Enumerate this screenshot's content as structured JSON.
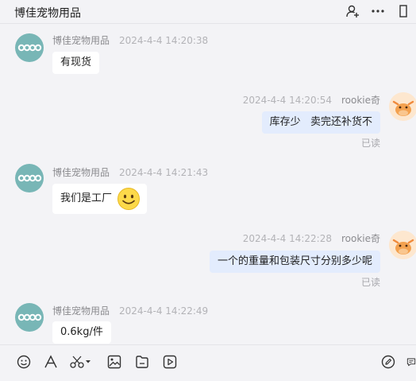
{
  "header": {
    "title": "博佳宠物用品"
  },
  "messages": [
    {
      "side": "left",
      "name": "博佳宠物用品",
      "time": "2024-4-4 14:20:38",
      "text": "有现货"
    },
    {
      "side": "right",
      "name": "rookie奇",
      "time": "2024-4-4 14:20:54",
      "text": "库存少   卖完还补货不",
      "status": "已读"
    },
    {
      "side": "left",
      "name": "博佳宠物用品",
      "time": "2024-4-4 14:21:43",
      "text": "我们是工厂",
      "emoji": "smile-emoji"
    },
    {
      "side": "right",
      "name": "rookie奇",
      "time": "2024-4-4 14:22:28",
      "text": "一个的重量和包装尺寸分别多少呢",
      "status": "已读"
    },
    {
      "side": "left",
      "name": "博佳宠物用品",
      "time": "2024-4-4 14:22:49",
      "text": "0.6kg/件"
    }
  ],
  "toolbar": {
    "icons": [
      "emoji-icon",
      "font-icon",
      "scissors-icon",
      "image-icon",
      "file-icon",
      "video-icon",
      "edit-icon",
      "chat-icon"
    ]
  },
  "colors": {
    "background": "#f3f3f6",
    "left_bubble": "#ffffff",
    "right_bubble": "#e3ecfd",
    "shop_avatar": "#78b6b6"
  }
}
